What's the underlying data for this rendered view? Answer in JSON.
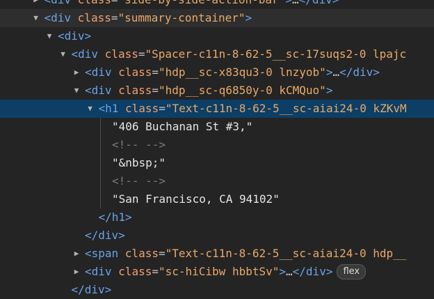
{
  "rows": [
    {
      "text_parts": [
        [
          "tag",
          "<div "
        ],
        [
          "attr",
          "class"
        ],
        [
          "punct",
          "="
        ],
        [
          "val",
          "\"side-by-side-action-bar\""
        ],
        [
          "tag",
          ">"
        ],
        [
          "ellip",
          "…"
        ],
        [
          "tag",
          "</div>"
        ]
      ],
      "indent": 1,
      "toggle": "collapsed",
      "highlight": ""
    },
    {
      "text_parts": [
        [
          "tag",
          "<div "
        ],
        [
          "attr",
          "class"
        ],
        [
          "punct",
          "="
        ],
        [
          "val",
          "\"summary-container\""
        ],
        [
          "tag",
          ">"
        ]
      ],
      "indent": 1,
      "toggle": "expanded",
      "highlight": "light"
    },
    {
      "text_parts": [
        [
          "tag",
          "<div>"
        ]
      ],
      "indent": 2,
      "toggle": "expanded",
      "highlight": ""
    },
    {
      "text_parts": [
        [
          "tag",
          "<div "
        ],
        [
          "attr",
          "class"
        ],
        [
          "punct",
          "="
        ],
        [
          "val",
          "\"Spacer-c11n-8-62-5__sc-17suqs2-0 lpajc"
        ]
      ],
      "indent": 3,
      "toggle": "expanded",
      "highlight": ""
    },
    {
      "text_parts": [
        [
          "tag",
          "<div "
        ],
        [
          "attr",
          "class"
        ],
        [
          "punct",
          "="
        ],
        [
          "val",
          "\"hdp__sc-x83qu3-0 lnzyob\""
        ],
        [
          "tag",
          ">"
        ],
        [
          "ellip",
          "…"
        ],
        [
          "tag",
          "</div>"
        ]
      ],
      "indent": 4,
      "toggle": "collapsed",
      "highlight": ""
    },
    {
      "text_parts": [
        [
          "tag",
          "<div "
        ],
        [
          "attr",
          "class"
        ],
        [
          "punct",
          "="
        ],
        [
          "val",
          "\"hdp__sc-q6850y-0 kCMQuo\""
        ],
        [
          "tag",
          ">"
        ]
      ],
      "indent": 4,
      "toggle": "expanded",
      "highlight": ""
    },
    {
      "text_parts": [
        [
          "tag",
          "<h1 "
        ],
        [
          "attr",
          "class"
        ],
        [
          "punct",
          "="
        ],
        [
          "val",
          "\"Text-c11n-8-62-5__sc-aiai24-0 kZKvM"
        ]
      ],
      "indent": 5,
      "toggle": "expanded",
      "highlight": "selected"
    },
    {
      "text_parts": [
        [
          "text",
          "\"406 Buchanan St #3,\""
        ]
      ],
      "indent": 6,
      "toggle": "",
      "highlight": ""
    },
    {
      "text_parts": [
        [
          "comment",
          "<!-- -->"
        ]
      ],
      "indent": 6,
      "toggle": "",
      "highlight": ""
    },
    {
      "text_parts": [
        [
          "text",
          "\"&nbsp;\""
        ]
      ],
      "indent": 6,
      "toggle": "",
      "highlight": ""
    },
    {
      "text_parts": [
        [
          "comment",
          "<!-- -->"
        ]
      ],
      "indent": 6,
      "toggle": "",
      "highlight": ""
    },
    {
      "text_parts": [
        [
          "text",
          "\"San Francisco, CA 94102\""
        ]
      ],
      "indent": 6,
      "toggle": "",
      "highlight": ""
    },
    {
      "text_parts": [
        [
          "tag",
          "</h1>"
        ]
      ],
      "indent": 5,
      "toggle": "",
      "highlight": ""
    },
    {
      "text_parts": [
        [
          "tag",
          "</div>"
        ]
      ],
      "indent": 4,
      "toggle": "",
      "highlight": ""
    },
    {
      "text_parts": [
        [
          "tag",
          "<span "
        ],
        [
          "attr",
          "class"
        ],
        [
          "punct",
          "="
        ],
        [
          "val",
          "\"Text-c11n-8-62-5__sc-aiai24-0 hdp__"
        ]
      ],
      "indent": 4,
      "toggle": "collapsed",
      "highlight": ""
    },
    {
      "text_parts": [
        [
          "tag",
          "<div "
        ],
        [
          "attr",
          "class"
        ],
        [
          "punct",
          "="
        ],
        [
          "val",
          "\"sc-hiCibw hbbtSv\""
        ],
        [
          "tag",
          ">"
        ],
        [
          "ellip",
          "…"
        ],
        [
          "tag",
          "</div>"
        ]
      ],
      "indent": 4,
      "toggle": "collapsed",
      "highlight": "",
      "badge": "flex"
    },
    {
      "text_parts": [
        [
          "tag",
          "</div>"
        ]
      ],
      "indent": 3,
      "toggle": "",
      "highlight": ""
    }
  ]
}
